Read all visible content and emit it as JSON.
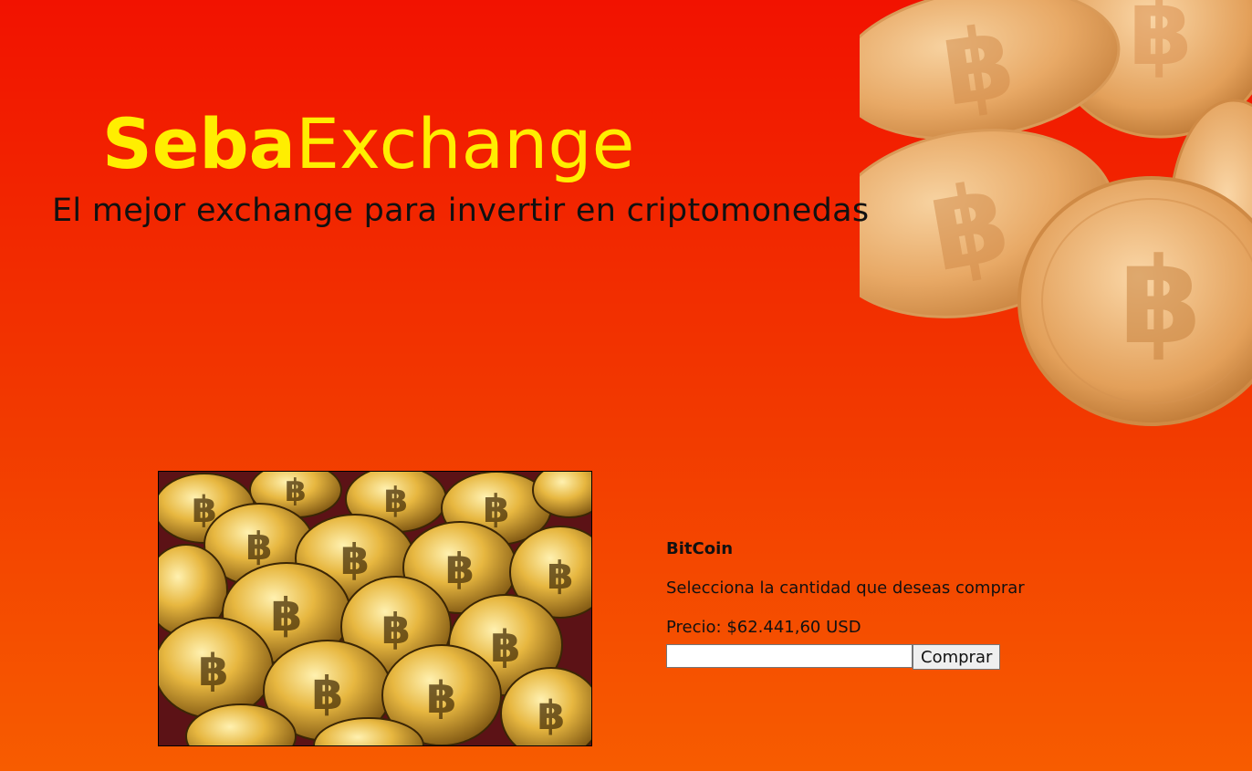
{
  "header": {
    "brand_bold": "Seba",
    "brand_regular": "Exchange",
    "tagline": "El mejor exchange para invertir en criptomonedas"
  },
  "product": {
    "name": "BitCoin",
    "prompt": "Selecciona la cantidad que deseas comprar",
    "price": "Precio: $62.441,60 USD",
    "quantity_value": "",
    "buy_label": "Comprar"
  },
  "colors": {
    "background_top": "#f21200",
    "background_bottom": "#f75c00",
    "brand": "#ffee00",
    "coin": "#e8b070"
  },
  "icons": {
    "hero": "bitcoin-coins-illustration",
    "product_image": "bitcoin-pile-photo"
  }
}
